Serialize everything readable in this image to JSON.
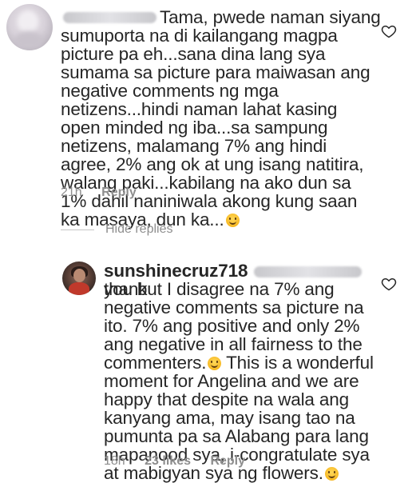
{
  "comment1": {
    "text_line1": "Tama, pwede naman siyang",
    "text_rest": "sumuporta na di kailangang magpa picture pa eh...sana dina lang sya sumama sa picture para maiwasan ang negative comments ng mga netizens...hindi naman lahat kasing open minded ng iba...sa sampung netizens, malamang 7% ang hindi agree, 2% ang ok at ung isang natitira, walang paki...kabilang na ako dun sa 1% dahil naniniwala akong kung saan ka masaya, dun ka...",
    "time": "21h",
    "reply_label": "Reply"
  },
  "hide_replies_label": "Hide replies",
  "comment2": {
    "username": "sunshinecruz718",
    "text_head": "thank",
    "text_rest": "you but I disagree na 7% ang negative comments sa picture na ito. 7% ang positive and only 2% ang negative in all fairness to the commenters.",
    "text_tail": " This is a wonderful moment for Angelina and we are happy that despite na wala ang kanyang ama, may isang tao na pumunta pa sa Alabang para lang mapanood sya, i-congratulate sya at mabigyan sya ng flowers.",
    "time": "18h",
    "likes": "23 likes",
    "reply_label": "Reply"
  }
}
